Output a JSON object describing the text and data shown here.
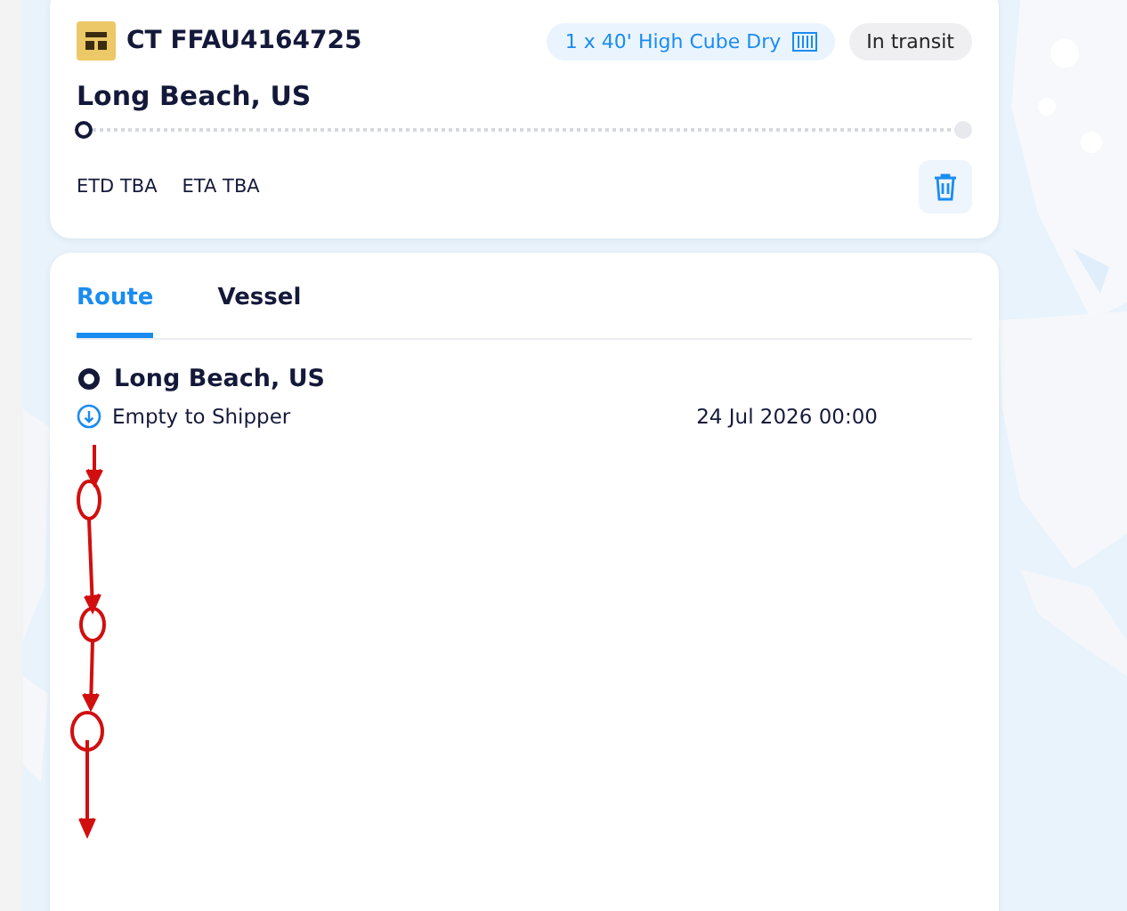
{
  "header": {
    "title": "CT FFAU4164725",
    "container": "1 x 40' High Cube Dry",
    "status": "In transit",
    "location": "Long Beach, US",
    "progress": {
      "level": 0
    },
    "etd": "ETD TBA",
    "eta": "ETA TBA"
  },
  "tabs": [
    {
      "label": "Route",
      "selected": true
    },
    {
      "label": "Vessel",
      "selected": false
    }
  ],
  "route": {
    "stops": [
      {
        "name": "Long Beach, US",
        "events": [
          {
            "label": "Empty to Shipper",
            "time": "24 Jul 2026 00:00"
          }
        ]
      }
    ]
  }
}
